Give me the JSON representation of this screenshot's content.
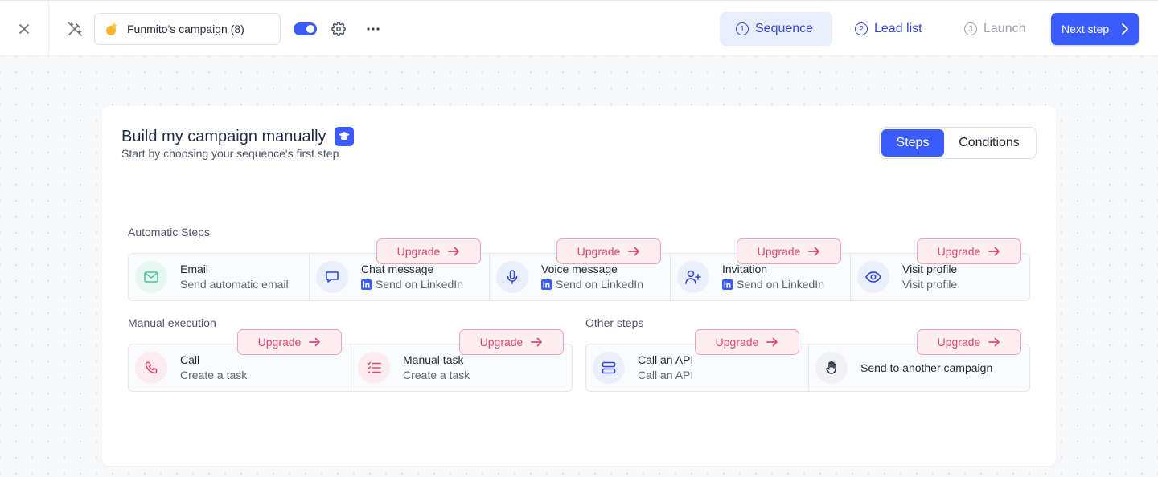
{
  "topbar": {
    "campaign_name": "Funmito's campaign (8)",
    "campaign_emoji": "star-emoji",
    "tabs": [
      {
        "num": "1",
        "label": "Sequence"
      },
      {
        "num": "2",
        "label": "Lead list"
      },
      {
        "num": "3",
        "label": "Launch"
      }
    ],
    "next_label": "Next step",
    "toggle_on": true
  },
  "card": {
    "title": "Build my campaign manually",
    "subtitle": "Start by choosing your sequence's first step",
    "segments": {
      "steps": "Steps",
      "conditions": "Conditions"
    }
  },
  "sections": {
    "automatic": "Automatic Steps",
    "manual": "Manual execution",
    "other": "Other steps"
  },
  "upgrade_label": "Upgrade",
  "automatic_steps": [
    {
      "title": "Email",
      "sub": "Send automatic email",
      "icon": "mail-icon",
      "linkedin": false,
      "upgrade": false
    },
    {
      "title": "Chat message",
      "sub": "Send on LinkedIn",
      "icon": "chat-icon",
      "linkedin": true,
      "upgrade": true
    },
    {
      "title": "Voice message",
      "sub": "Send on LinkedIn",
      "icon": "microphone-icon",
      "linkedin": true,
      "upgrade": true
    },
    {
      "title": "Invitation",
      "sub": "Send on LinkedIn",
      "icon": "add-user-icon",
      "linkedin": true,
      "upgrade": true
    },
    {
      "title": "Visit profile",
      "sub": "Visit profile",
      "icon": "eye-icon",
      "linkedin": false,
      "upgrade": true
    }
  ],
  "manual_steps": [
    {
      "title": "Call",
      "sub": "Create a task",
      "icon": "phone-icon",
      "upgrade": true
    },
    {
      "title": "Manual task",
      "sub": "Create a task",
      "icon": "checklist-icon",
      "upgrade": true
    }
  ],
  "other_steps": [
    {
      "title": "Call an API",
      "sub": "Call an API",
      "icon": "server-icon",
      "upgrade": true
    },
    {
      "title": "Send to another campaign",
      "sub": "",
      "icon": "hand-icon",
      "upgrade": true
    }
  ],
  "colors": {
    "accent": "#3b5bfd",
    "upgrade_text": "#e3466e",
    "upgrade_bg": "#fdeef2",
    "email_icon_bg": "#e7f8f1",
    "linkedin_icon_bg": "#eaf0fb",
    "manual_icon_bg": "#fdecef"
  }
}
